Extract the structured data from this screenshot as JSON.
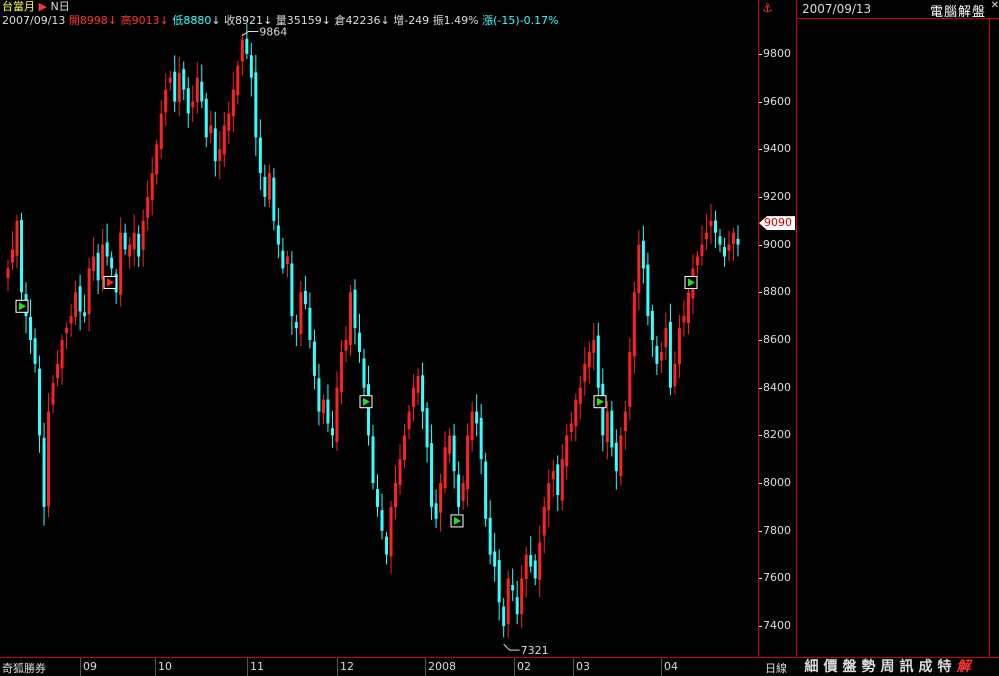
{
  "header": {
    "symbol": "台當月",
    "period_type": "N日",
    "date": "2007/09/13",
    "open_label": "開8998",
    "high_label": "高9013",
    "low_label": "低8880",
    "close_label": "收8921",
    "volume_label": "量35159",
    "oi_label": "倉42236",
    "change_oi_label": "增-249",
    "amplitude_label": "振1.49%",
    "change_label": "漲(-15)-0.17%"
  },
  "y_axis": {
    "ticks": [
      "9800",
      "9600",
      "9400",
      "9200",
      "9000",
      "8800",
      "8600",
      "8400",
      "8200",
      "8000",
      "7800",
      "7600",
      "7400"
    ],
    "current_price": "9090"
  },
  "annotations": {
    "high_mark": "9864",
    "low_mark": "7321"
  },
  "x_axis": {
    "ticks": [
      "09",
      "10",
      "11",
      "12",
      "2008",
      "02",
      "03",
      "04"
    ]
  },
  "bottom": {
    "broker": "奇狐勝券",
    "period": "日線",
    "tabs": [
      "細",
      "價",
      "盤",
      "勢",
      "周",
      "訊",
      "成",
      "特",
      "解"
    ],
    "active_tab": "解"
  },
  "side": {
    "date": "2007/09/13",
    "title": "電腦解盤"
  },
  "colors": {
    "up": "#ff2222",
    "down": "#33ffff",
    "border": "#cc0000"
  },
  "chart_data": {
    "type": "candlestick",
    "ylim": [
      7300,
      9900
    ],
    "closes": [
      8900,
      8980,
      9100,
      8800,
      8700,
      8600,
      8500,
      8200,
      7900,
      8300,
      8420,
      8500,
      8600,
      8650,
      8700,
      8800,
      8720,
      8700,
      8900,
      8950,
      8850,
      9000,
      8950,
      8900,
      8800,
      9050,
      8980,
      9000,
      9050,
      8950,
      9100,
      9200,
      9300,
      9420,
      9550,
      9650,
      9700,
      9600,
      9720,
      9650,
      9550,
      9600,
      9700,
      9600,
      9450,
      9500,
      9350,
      9400,
      9500,
      9550,
      9650,
      9750,
      9860,
      9800,
      9700,
      9450,
      9300,
      9200,
      9300,
      9100,
      9000,
      8900,
      8950,
      8700,
      8650,
      8800,
      8750,
      8600,
      8450,
      8300,
      8350,
      8250,
      8200,
      8400,
      8550,
      8600,
      8800,
      8650,
      8550,
      8400,
      8200,
      8000,
      7900,
      7800,
      7700,
      7900,
      8000,
      8100,
      8200,
      8300,
      8400,
      8450,
      8300,
      8150,
      7900,
      7850,
      8000,
      8150,
      8200,
      8050,
      7900,
      8000,
      8200,
      8300,
      8250,
      8100,
      7850,
      7700,
      7650,
      7500,
      7400,
      7600,
      7550,
      7450,
      7600,
      7700,
      7650,
      7600,
      7750,
      7900,
      8000,
      8050,
      7950,
      8100,
      8200,
      8250,
      8350,
      8400,
      8500,
      8550,
      8600,
      8400,
      8200,
      8300,
      8150,
      8050,
      8200,
      8300,
      8550,
      8800,
      9000,
      8900,
      8700,
      8600,
      8500,
      8550,
      8650,
      8400,
      8500,
      8650,
      8700,
      8800,
      8900,
      8950,
      9000,
      9050,
      9100,
      9050,
      9000,
      8950,
      9000,
      9050,
      9000
    ]
  }
}
